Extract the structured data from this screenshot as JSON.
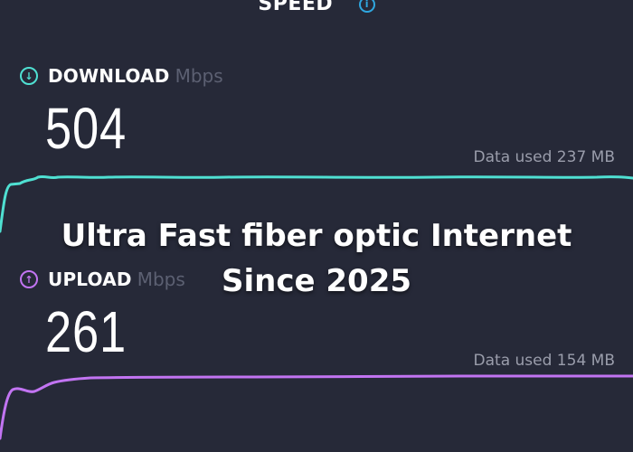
{
  "header": {
    "title": "SPEED",
    "info_icon": "info-icon"
  },
  "download": {
    "label": "DOWNLOAD",
    "unit": "Mbps",
    "value": "504",
    "data_used": "Data used 237 MB",
    "icon": "arrow-down-circle-icon",
    "color": "#4fe0d2"
  },
  "upload": {
    "label": "UPLOAD",
    "unit": "Mbps",
    "value": "261",
    "data_used": "Data used 154 MB",
    "icon": "arrow-up-circle-icon",
    "color": "#c274f2"
  },
  "overlay": {
    "line1": "Ultra Fast fiber optic Internet",
    "line2": "Since 2025"
  },
  "colors": {
    "background": "#262938",
    "muted_text": "#5c6072",
    "data_text": "#9a9dab",
    "info_accent": "#2fa7e0"
  }
}
